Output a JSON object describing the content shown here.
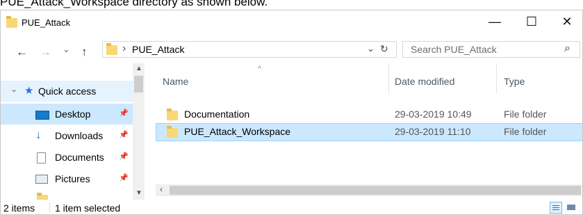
{
  "caption": "PUE_Attack_Workspace directory as shown below.",
  "window": {
    "title": "PUE_Attack",
    "minimize": "—",
    "maximize": "☐",
    "close": "✕"
  },
  "address": {
    "back": "←",
    "forward": "→",
    "recent": "⌄",
    "up": "↑",
    "separator": "›",
    "path": "PUE_Attack",
    "dropdown": "⌄",
    "refresh": "↻",
    "search_placeholder": "Search PUE_Attack",
    "search_icon": "⌕"
  },
  "sidebar": {
    "quick_access": "Quick access",
    "items": [
      {
        "label": "Desktop",
        "icon": "desktop-icon",
        "pinned": true
      },
      {
        "label": "Downloads",
        "icon": "downloads-icon",
        "pinned": true
      },
      {
        "label": "Documents",
        "icon": "documents-icon",
        "pinned": true
      },
      {
        "label": "Pictures",
        "icon": "pictures-icon",
        "pinned": true
      }
    ]
  },
  "columns": {
    "name": "Name",
    "date": "Date modified",
    "type": "Type",
    "sort_indicator": "^"
  },
  "rows": [
    {
      "name": "Documentation",
      "date": "29-03-2019 10:49",
      "type": "File folder",
      "selected": false
    },
    {
      "name": "PUE_Attack_Workspace",
      "date": "29-03-2019 11:10",
      "type": "File folder",
      "selected": true
    }
  ],
  "status": {
    "items": "2 items",
    "selection": "1 item selected"
  },
  "colors": {
    "selection_bg": "#cce8ff",
    "selection_border": "#99d1ff",
    "folder": "#f8d775",
    "quick_access_star": "#2b74d6"
  }
}
